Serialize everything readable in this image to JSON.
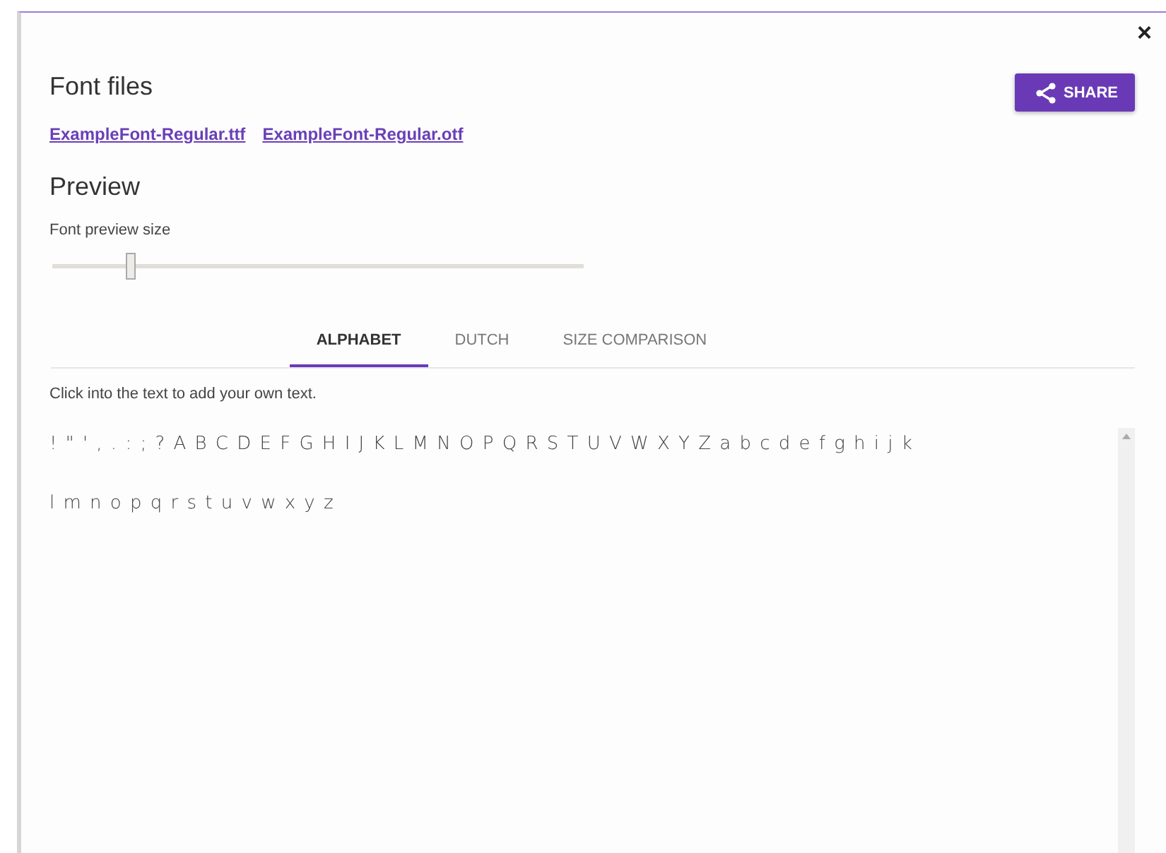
{
  "dialog": {
    "close": "×"
  },
  "font_files": {
    "title": "Font files",
    "links": [
      "ExampleFont-Regular.ttf",
      "ExampleFont-Regular.otf"
    ]
  },
  "share_button": {
    "label": "SHARE"
  },
  "preview": {
    "title": "Preview",
    "size_label": "Font preview size",
    "size_slider": {
      "level": 0.15
    },
    "tabs": [
      {
        "label": "ALPHABET",
        "selected": true
      },
      {
        "label": "DUTCH",
        "selected": false
      },
      {
        "label": "SIZE COMPARISON",
        "selected": false
      }
    ],
    "hint": "Click into the text to add your own text.",
    "text_lines": [
      "! \" ' , . : ; ? A B C D E F G H I J K L M N O P Q R S T U V W X Y Z a b c d e f g h i j k",
      "l m n o p q r s t u v w x y z"
    ]
  }
}
